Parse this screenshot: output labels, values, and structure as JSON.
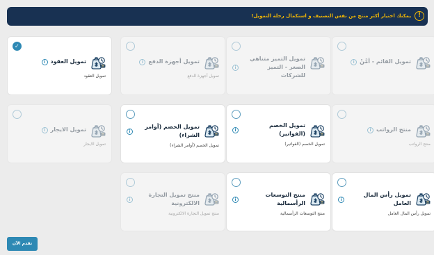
{
  "banner": {
    "message": "يمكنك اختيار أكثر منتج من نفس التصنيف و استكمال رحلة التمويل!",
    "icon": "warning-icon"
  },
  "products": [
    {
      "title": "تمويل العقود",
      "subtitle": "تمويل العقود",
      "selected": true,
      "enabled": true
    },
    {
      "title": "تمويل أجهزة الدفع",
      "subtitle": "تمويل أجهزة الدفع",
      "selected": false,
      "enabled": false
    },
    {
      "title": "تمويل التميز متناهي الصغر - التميز للشركات",
      "subtitle": "",
      "selected": false,
      "enabled": false
    },
    {
      "title": "تمويل القائم - أمَّنْ",
      "subtitle": "",
      "selected": false,
      "enabled": false
    },
    {
      "title": "تمويل الايجار",
      "subtitle": "تمويل الايجار",
      "selected": false,
      "enabled": false
    },
    {
      "title": "تمويل الخصم (أوامر الشراء)",
      "subtitle": "تمويل الخصم (أوامر الشراء)",
      "selected": false,
      "enabled": true
    },
    {
      "title": "تمويل الخصم (الفواتير)",
      "subtitle": "تمويل الخصم (الفواتير)",
      "selected": false,
      "enabled": true
    },
    {
      "title": "منتج الرواتب",
      "subtitle": "منتج الرواتب",
      "selected": false,
      "enabled": false
    },
    {
      "title": "منتج تمويل التجارة الالكترونية",
      "subtitle": "منتج تمويل التجارة الالكترونية",
      "selected": false,
      "enabled": false
    },
    {
      "title": "منتج التوسعات الرأسمالية",
      "subtitle": "منتج التوسعات الرأسمالية",
      "selected": false,
      "enabled": true
    },
    {
      "title": "تمويل رأس المال العامل",
      "subtitle": "تمويل رأس المال العامل",
      "selected": false,
      "enabled": true
    }
  ],
  "next_button": {
    "label": "تقدم الآن"
  },
  "colors": {
    "navy": "#183152",
    "accent": "#2e89b4",
    "warning": "#f2b705"
  }
}
